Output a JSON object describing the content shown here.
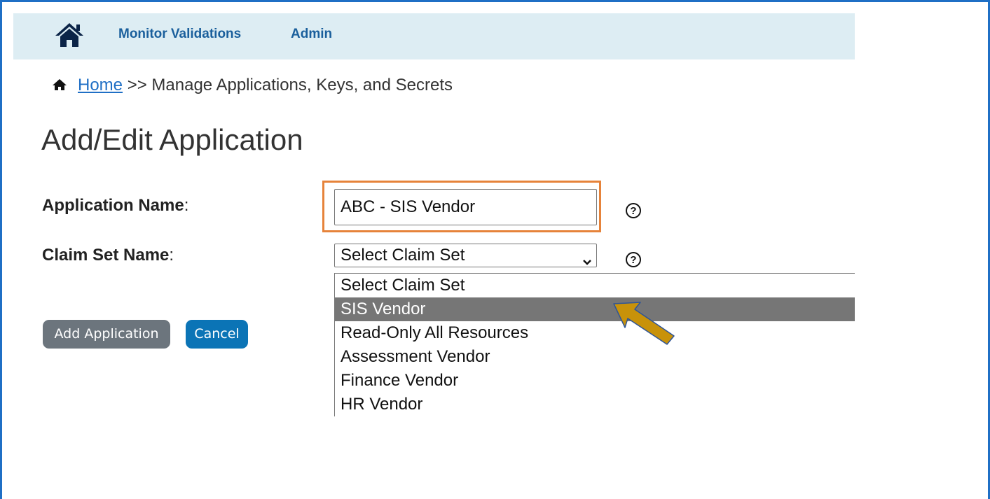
{
  "nav": {
    "home_icon": "home-icon",
    "links": [
      "Monitor Validations",
      "Admin"
    ]
  },
  "breadcrumb": {
    "home_icon": "home-icon",
    "home_label": "Home",
    "separator": ">>",
    "current": "Manage Applications, Keys, and Secrets"
  },
  "page": {
    "title": "Add/Edit Application"
  },
  "form": {
    "application_name_label": "Application Name",
    "application_name_value": "ABC - SIS Vendor",
    "claim_set_label": "Claim Set Name",
    "colon": ":",
    "help_icon": "help-circle-icon",
    "help_glyph": "?",
    "claim_set_selected": "Select Claim Set",
    "claim_set_options": [
      "Select Claim Set",
      "SIS Vendor",
      "Read-Only All Resources",
      "Assessment Vendor",
      "Finance Vendor",
      "HR Vendor"
    ],
    "highlighted_option": "SIS Vendor"
  },
  "buttons": {
    "add_label": "Add Application",
    "cancel_label": "Cancel"
  },
  "colors": {
    "frame_border": "#1f6fc5",
    "nav_bg": "#ddedf3",
    "nav_link": "#1a5f9c",
    "highlight_box": "#e6833a",
    "arrow_fill": "#c8920a",
    "arrow_stroke": "#2f5597",
    "add_button": "#6c757d",
    "cancel_button": "#0b74b6",
    "option_highlight": "#767676"
  }
}
